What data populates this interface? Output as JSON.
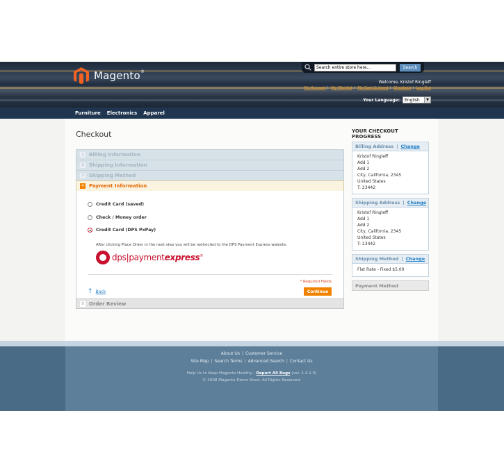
{
  "header": {
    "logo_text": "Magento",
    "logo_mark": "®",
    "search": {
      "placeholder": "Search entire store here...",
      "button_label": "Search"
    },
    "welcome": "Welcome, Kristof Ringleff",
    "top_links": [
      "My Account",
      "My Wishlist",
      "My Cart (1 item)",
      "Checkout",
      "Log Out"
    ],
    "language_label": "Your Language:",
    "language_value": "English"
  },
  "nav": {
    "items": [
      "Furniture",
      "Electronics",
      "Apparel"
    ]
  },
  "checkout": {
    "title": "Checkout",
    "steps": [
      {
        "num": "1",
        "label": "Billing Information"
      },
      {
        "num": "2",
        "label": "Shipping Information"
      },
      {
        "num": "3",
        "label": "Shipping Method"
      },
      {
        "num": "4",
        "label": "Payment Information"
      },
      {
        "num": "5",
        "label": "Order Review"
      }
    ],
    "payment_methods": [
      "Credit Card (saved)",
      "Check / Money order",
      "Credit Card (DPS PxPay)"
    ],
    "dps_note": "After clicking Place Order in the next step you will be redirected to the DPS Payment Express website.",
    "dps_logo": {
      "thin": "dps|payment",
      "bold": "express",
      "mark": "®"
    },
    "required_note": "* Required Fields",
    "back_label": "Back",
    "continue_label": "Continue"
  },
  "progress": {
    "title": "YOUR CHECKOUT PROGRESS",
    "change_label": "Change",
    "billing": {
      "title": "Billing Address",
      "lines": [
        "Kristof Ringleff",
        "Add 1",
        "Add 2",
        "City, California, 2345",
        "United States",
        "T: 23442"
      ]
    },
    "shipping": {
      "title": "Shipping Address",
      "lines": [
        "Kristof Ringleff",
        "Add 1",
        "Add 2",
        "City, California, 2345",
        "United States",
        "T: 23442"
      ]
    },
    "method": {
      "title": "Shipping Method",
      "value": "Flat Rate - Fixed $5.00"
    },
    "payment": {
      "title": "Payment Method"
    }
  },
  "footer": {
    "row1": [
      "About Us",
      "Customer Service"
    ],
    "row2": [
      "Site Map",
      "Search Terms",
      "Advanced Search",
      "Contact Us"
    ],
    "help_prefix": "Help Us to Keep Magento Healthy - ",
    "help_link": "Report All Bugs",
    "help_suffix": " (ver. 1.4.1.0)",
    "copyright": "© 2008 Magento Demo Store. All Rights Reserved."
  },
  "colors": {
    "accent": "#f18200",
    "link": "#1e7ec8",
    "nav_bg": "#1f3550",
    "footer_bg": "#5d7f9a"
  }
}
